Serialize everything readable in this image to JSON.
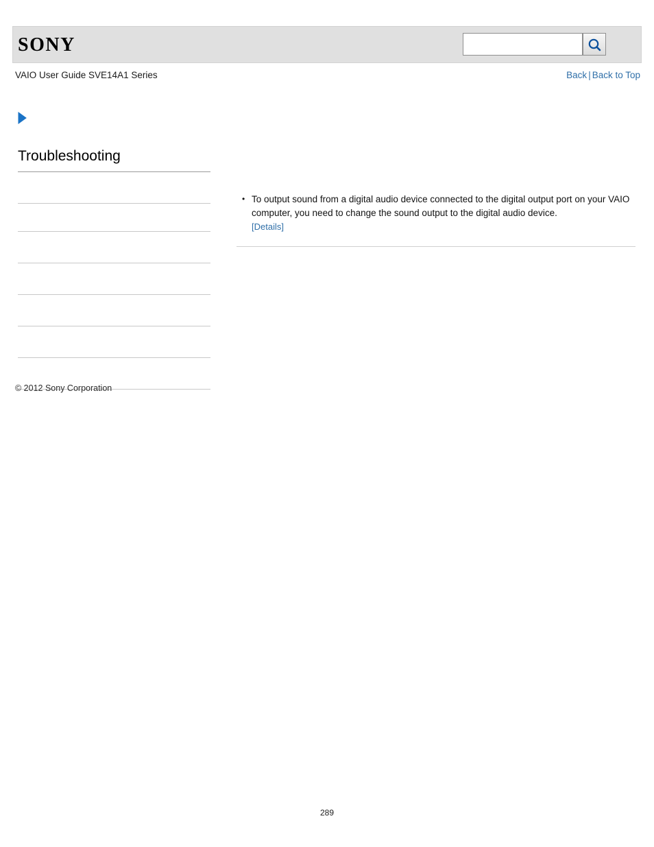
{
  "header": {
    "logo_text": "SONY",
    "search": {
      "value": "",
      "placeholder": "",
      "button_icon": "search-icon"
    }
  },
  "titlebar": {
    "guide_title": "VAIO User Guide SVE14A1 Series",
    "back_label": "Back",
    "separator": "|",
    "back_to_top_label": "Back to Top"
  },
  "marker": {
    "icon": "chevron-right-icon"
  },
  "sidebar": {
    "heading": "Troubleshooting",
    "divider_count": 8
  },
  "content": {
    "bullets": [
      {
        "text": "To output sound from a digital audio device connected to the digital output port on your VAIO computer, you need to change the sound output to the digital audio device.",
        "link_label": "[Details]"
      }
    ]
  },
  "footer": {
    "copyright": "© 2012 Sony Corporation",
    "page_number": "289"
  },
  "colors": {
    "link": "#2f6fa8",
    "header_bg": "#e0e0e0",
    "accent_arrow": "#1a73c6"
  }
}
